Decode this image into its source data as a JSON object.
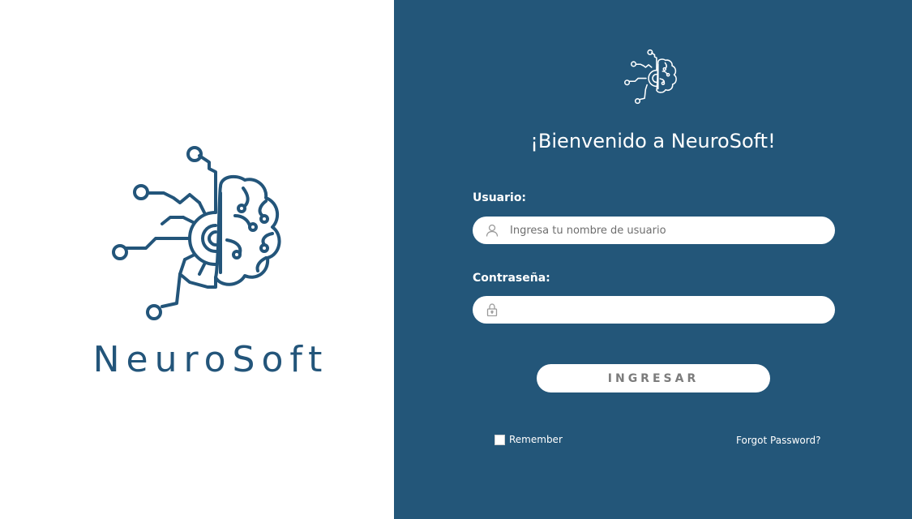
{
  "brand": {
    "name": "NeuroSoft",
    "logo_icon": "brain-circuit-icon",
    "logo_color": "#23557a"
  },
  "panel": {
    "background": "#235679",
    "welcome": "¡Bienvenido a NeuroSoft!"
  },
  "form": {
    "username_label": "Usuario:",
    "username_placeholder": "Ingresa tu nombre de usuario",
    "username_value": "",
    "password_label": "Contraseña:",
    "password_placeholder": "",
    "password_value": "",
    "submit_label": "INGRESAR",
    "remember_label": "Remember",
    "remember_checked": false,
    "forgot_label": "Forgot Password?"
  }
}
